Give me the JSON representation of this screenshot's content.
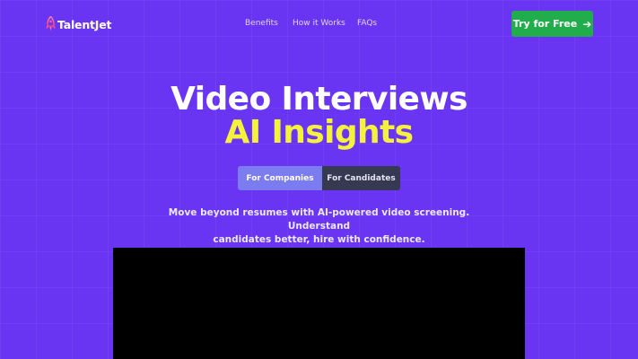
{
  "header": {
    "logo_text": "TalentJet",
    "logo_icon": "rocket-icon",
    "nav": [
      {
        "label": "Benefits"
      },
      {
        "label": "How it Works"
      },
      {
        "label": "FAQs"
      }
    ],
    "cta_label": "Try for Free",
    "cta_icon": "arrow-right-icon",
    "cta_color": "#21ad4b"
  },
  "hero": {
    "title_line1": "Video Interviews",
    "title_line2": "AI Insights",
    "title_line2_color": "#f5f23d",
    "toggle": {
      "options": [
        {
          "label": "For Companies",
          "selected": true
        },
        {
          "label": "For Candidates",
          "selected": false
        }
      ]
    },
    "subtitle_line1": "Move beyond resumes with AI-powered video screening. Understand",
    "subtitle_line2": "candidates better, hire with confidence."
  },
  "theme": {
    "background": "#6a35f2"
  }
}
